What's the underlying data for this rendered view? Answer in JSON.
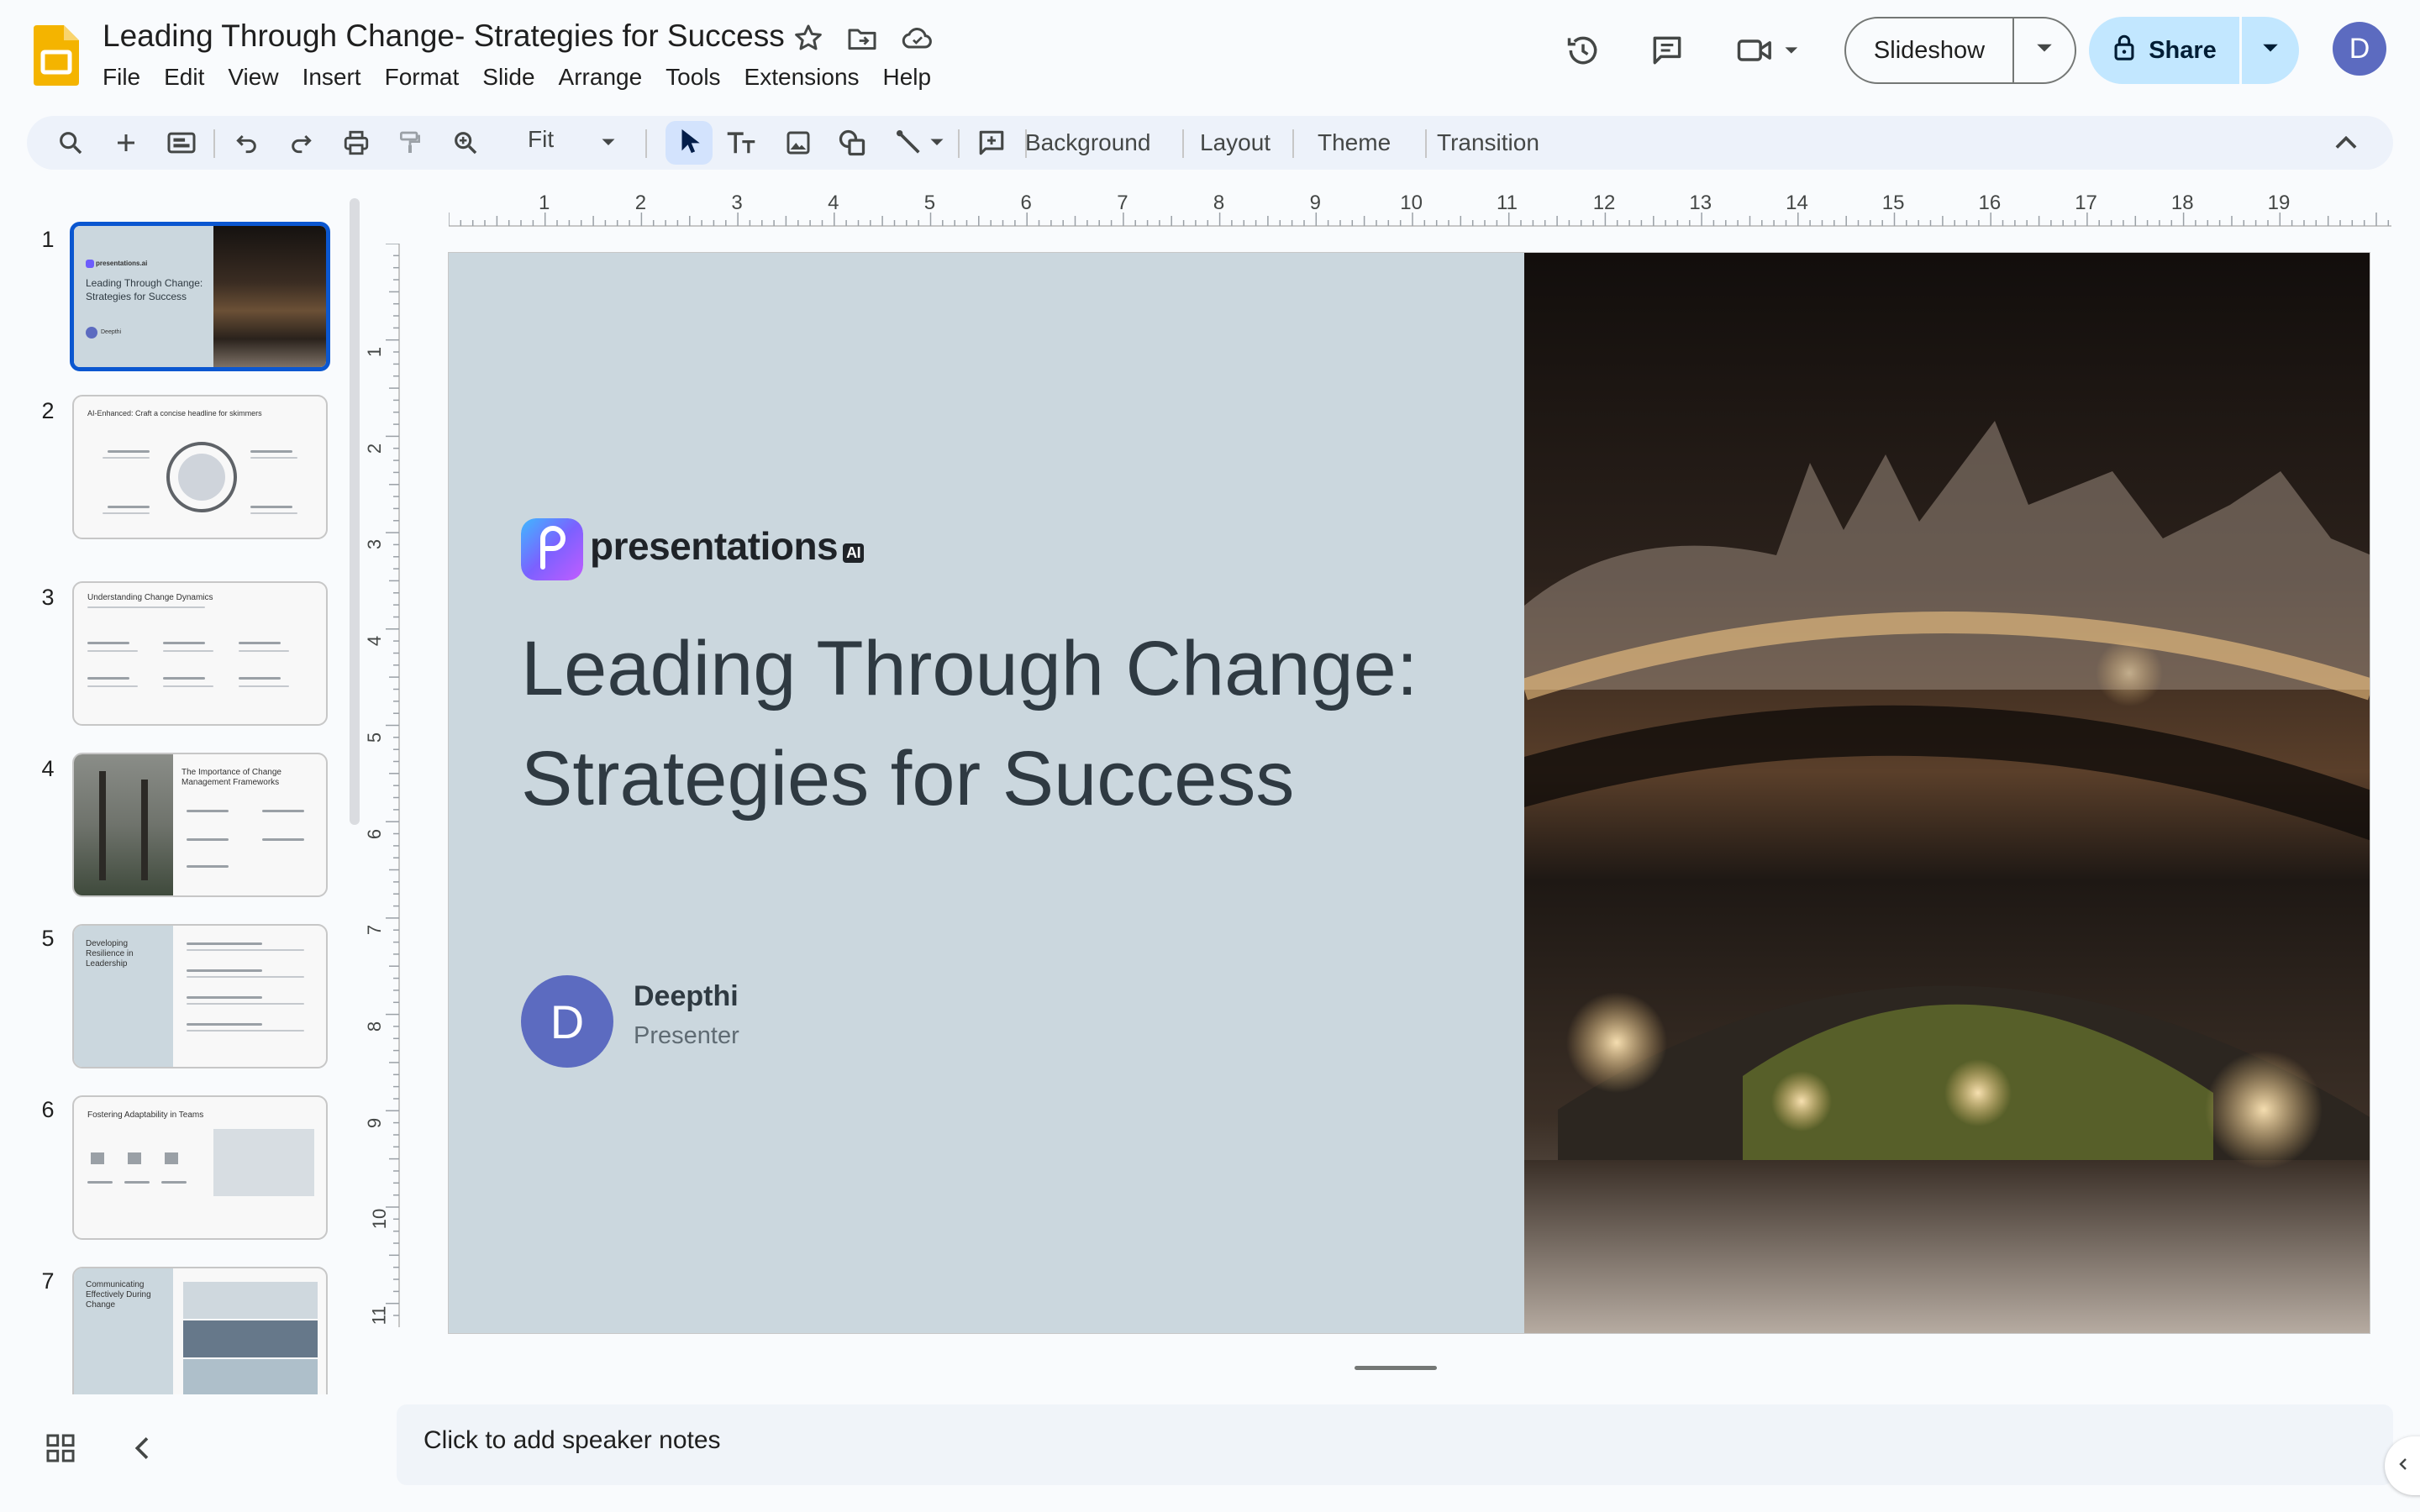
{
  "document": {
    "title": "Leading Through Change- Strategies for Success"
  },
  "menu": [
    "File",
    "Edit",
    "View",
    "Insert",
    "Format",
    "Slide",
    "Arrange",
    "Tools",
    "Extensions",
    "Help"
  ],
  "header": {
    "slideshow_label": "Slideshow",
    "share_label": "Share",
    "avatar_letter": "D"
  },
  "toolbar": {
    "zoom_value": "Fit",
    "background_label": "Background",
    "layout_label": "Layout",
    "theme_label": "Theme",
    "transition_label": "Transition"
  },
  "ruler": {
    "horizontal": [
      "1",
      "2",
      "3",
      "4",
      "5",
      "6",
      "7",
      "8",
      "9",
      "10",
      "11",
      "12",
      "13",
      "14",
      "15",
      "16",
      "17",
      "18",
      "19"
    ],
    "vertical": [
      "1",
      "2",
      "3",
      "4",
      "5",
      "6",
      "7",
      "8",
      "9",
      "10",
      "11"
    ]
  },
  "filmstrip": {
    "slides": [
      {
        "number": "1",
        "title": "Leading Through Change: Strategies for Success",
        "brand": "presentations.ai",
        "presenter": "Deepthi"
      },
      {
        "number": "2",
        "title": "AI-Enhanced: Craft a concise headline for skimmers"
      },
      {
        "number": "3",
        "title": "Understanding Change Dynamics"
      },
      {
        "number": "4",
        "title": "The Importance of Change Management Frameworks"
      },
      {
        "number": "5",
        "title": "Developing Resilience in Leadership"
      },
      {
        "number": "6",
        "title": "Fostering Adaptability in Teams"
      },
      {
        "number": "7",
        "title": "Communicating Effectively During Change"
      }
    ]
  },
  "slide": {
    "brand_name": "presentations",
    "brand_suffix": "AI",
    "title": "Leading Through Change: Strategies for Success",
    "presenter_initial": "D",
    "presenter_name": "Deepthi",
    "presenter_role": "Presenter"
  },
  "notes": {
    "placeholder": "Click to add speaker notes"
  },
  "colors": {
    "accent_blue": "#0b57d0",
    "share_bg": "#c2e7ff",
    "slide_bg": "#cbd7de",
    "avatar": "#5c6bc0"
  }
}
